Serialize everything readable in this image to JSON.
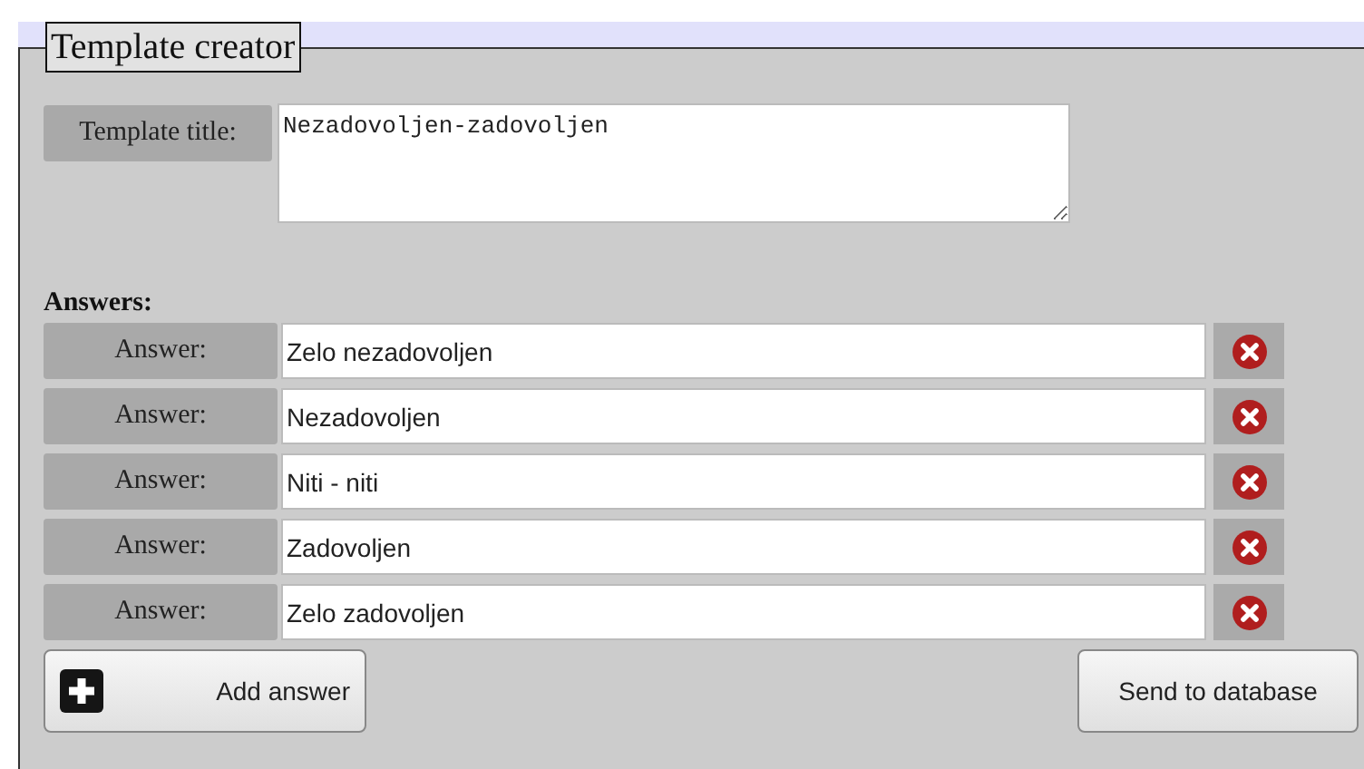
{
  "legend": "Template creator",
  "title_field": {
    "label": "Template title:",
    "value": "Nezadovoljen-zadovoljen"
  },
  "answers_heading": "Answers:",
  "answers": [
    {
      "label": "Answer:",
      "value": "Zelo nezadovoljen"
    },
    {
      "label": "Answer:",
      "value": "Nezadovoljen"
    },
    {
      "label": "Answer:",
      "value": "Niti - niti"
    },
    {
      "label": "Answer:",
      "value": "Zadovoljen"
    },
    {
      "label": "Answer:",
      "value": "Zelo zadovoljen"
    }
  ],
  "buttons": {
    "add": "Add answer",
    "send": "Send to database"
  }
}
